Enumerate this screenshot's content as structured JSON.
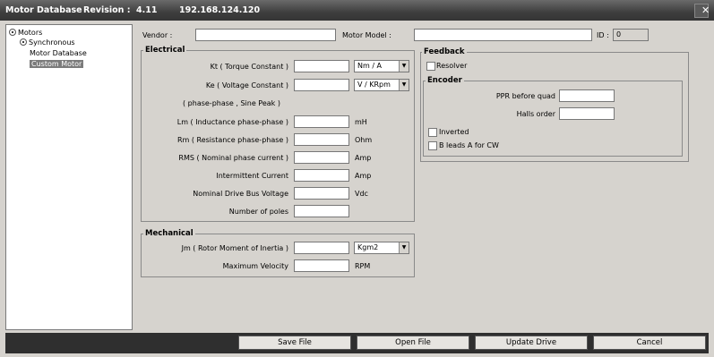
{
  "window": {
    "title": "Motor Database",
    "revision_label": "Revision :",
    "revision_value": "4.11",
    "ip": "192.168.124.120"
  },
  "tree": {
    "root": "Motors",
    "child": "Synchronous",
    "items": [
      "Motor Database",
      "Custom Motor"
    ],
    "selected": "Custom Motor"
  },
  "header": {
    "vendor_label": "Vendor :",
    "vendor_value": "",
    "model_label": "Motor Model :",
    "model_value": "",
    "id_label": "ID :",
    "id_value": "0"
  },
  "electrical": {
    "title": "Electrical",
    "kt_label": "Kt ( Torque Constant )",
    "kt_value": "",
    "kt_unit": "Nm / A",
    "ke_label": "Ke ( Voltage Constant )",
    "ke_value": "",
    "ke_unit": "V / KRpm",
    "ke_note": "( phase-phase , Sine Peak )",
    "lm_label": "Lm ( Inductance phase-phase )",
    "lm_value": "",
    "lm_unit": "mH",
    "rm_label": "Rm ( Resistance phase-phase )",
    "rm_value": "",
    "rm_unit": "Ohm",
    "rms_label": "RMS ( Nominal phase current )",
    "rms_value": "",
    "rms_unit": "Amp",
    "int_label": "Intermittent Current",
    "int_value": "",
    "int_unit": "Amp",
    "bus_label": "Nominal Drive Bus Voltage",
    "bus_value": "",
    "bus_unit": "Vdc",
    "poles_label": "Number of poles",
    "poles_value": ""
  },
  "mechanical": {
    "title": "Mechanical",
    "jm_label": "Jm ( Rotor Moment of Inertia )",
    "jm_value": "",
    "jm_unit": "Kgm2",
    "vel_label": "Maximum Velocity",
    "vel_value": "",
    "vel_unit": "RPM"
  },
  "feedback": {
    "title": "Feedback",
    "resolver_label": "Resolver",
    "encoder_title": "Encoder",
    "ppr_label": "PPR before quad",
    "ppr_value": "",
    "halls_label": "Halls order",
    "halls_value": "",
    "inverted_label": "Inverted",
    "bleads_label": "B leads A for CW"
  },
  "buttons": {
    "save": "Save File",
    "open": "Open File",
    "update": "Update Drive",
    "cancel": "Cancel"
  },
  "colors": {
    "titlebar": "#3e3e3e",
    "window_bg": "#d6d3ce",
    "statusbar": "#2f2f2f",
    "selection": "#7b7b7b"
  }
}
